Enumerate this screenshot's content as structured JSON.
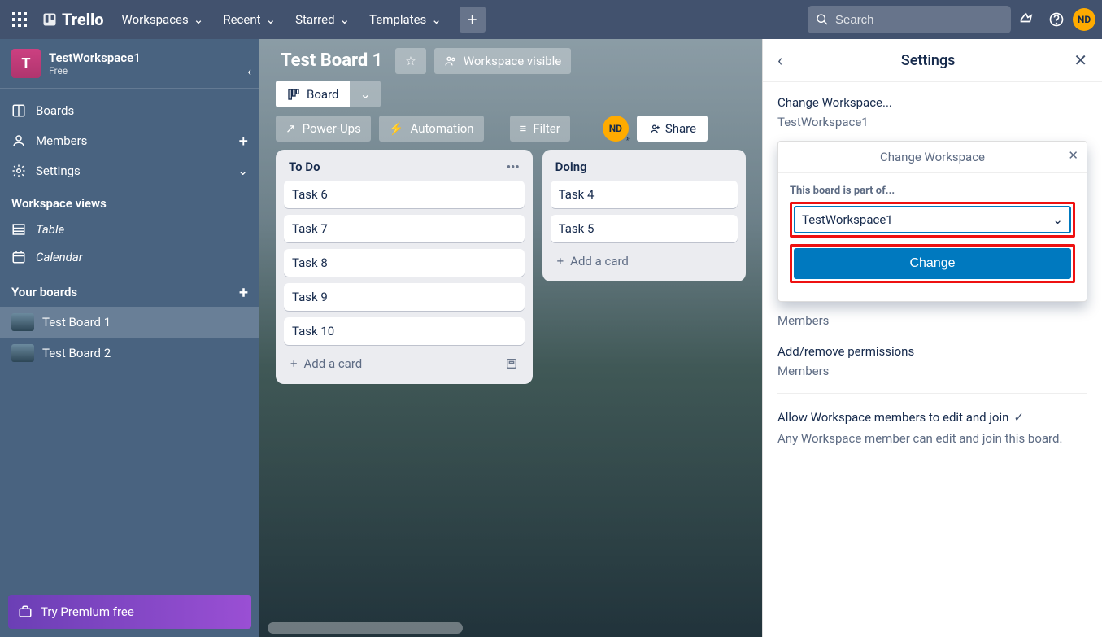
{
  "topbar": {
    "logo": "Trello",
    "nav": [
      "Workspaces",
      "Recent",
      "Starred",
      "Templates"
    ],
    "search_placeholder": "Search",
    "avatar": "ND"
  },
  "sidebar": {
    "workspace_badge": "T",
    "workspace_name": "TestWorkspace1",
    "workspace_plan": "Free",
    "items": [
      {
        "label": "Boards"
      },
      {
        "label": "Members"
      },
      {
        "label": "Settings"
      }
    ],
    "views_heading": "Workspace views",
    "views": [
      {
        "label": "Table"
      },
      {
        "label": "Calendar"
      }
    ],
    "boards_heading": "Your boards",
    "boards": [
      {
        "label": "Test Board 1",
        "active": true
      },
      {
        "label": "Test Board 2",
        "active": false
      }
    ],
    "premium": "Try Premium free"
  },
  "board": {
    "title": "Test Board 1",
    "visibility": "Workspace visible",
    "view_label": "Board",
    "powerups": "Power-Ups",
    "automation": "Automation",
    "filter": "Filter",
    "member": "ND",
    "share": "Share"
  },
  "lists": [
    {
      "title": "To Do",
      "cards": [
        "Task 6",
        "Task 7",
        "Task 8",
        "Task 9",
        "Task 10"
      ]
    },
    {
      "title": "Doing",
      "cards": [
        "Task 4",
        "Task 5"
      ]
    }
  ],
  "add_card": "Add a card",
  "panel": {
    "title": "Settings",
    "change_workspace_link": "Change Workspace...",
    "current_workspace": "TestWorkspace1",
    "popover_title": "Change Workspace",
    "field_label": "This board is part of...",
    "select_value": "TestWorkspace1",
    "change_button": "Change",
    "members_label1": "Members",
    "add_remove": "Add/remove permissions",
    "members_label2": "Members",
    "allow_edit": "Allow Workspace members to edit and join",
    "allow_edit_desc": "Any Workspace member can edit and join this board."
  }
}
